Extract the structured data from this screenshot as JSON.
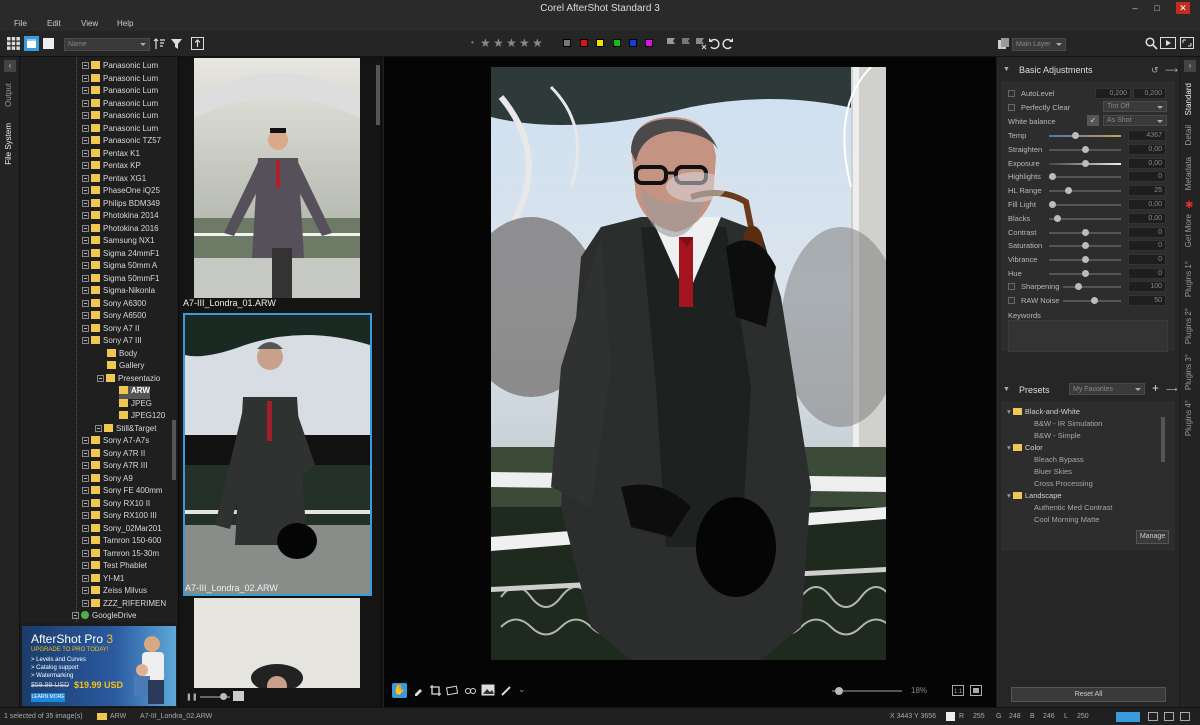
{
  "window": {
    "title": "Corel AfterShot Standard 3"
  },
  "menu": {
    "file": "File",
    "edit": "Edit",
    "view": "View",
    "help": "Help"
  },
  "toolbar": {
    "sort_by": "Name",
    "layer": "Main Layer"
  },
  "left_tabs": {
    "output": "Output",
    "file_system": "File System"
  },
  "tree": {
    "items": [
      "Panasonic Lum",
      "Panasonic Lum",
      "Panasonic Lum",
      "Panasonic Lum",
      "Panasonic Lum",
      "Panasonic Lum",
      "Panasonic TZ57",
      "Pentax K1",
      "Pentax KP",
      "Pentax XG1",
      "PhaseOne iQ25",
      "Philips BDM349",
      "Photokina 2014",
      "Photokina 2016",
      "Samsung NX1",
      "Sigma 24mmF1",
      "Sigma 50mm A",
      "Sigma 50mmF1",
      "Sigma-Nikonla",
      "Sony A6300",
      "Sony A6500",
      "Sony A7 II",
      "Sony A7 III"
    ],
    "sub_a7iii": [
      "Body",
      "Gallery",
      "Presentazio"
    ],
    "sub_pres": [
      "ARW",
      "JPEG",
      "JPEG120"
    ],
    "still_target": "Still&Target",
    "after": [
      "Sony A7-A7s",
      "Sony A7R II",
      "Sony A7R III",
      "Sony A9",
      "Sony FE 400mm",
      "Sony RX10 II",
      "Sony RX100 III",
      "Sony_02Mar201",
      "Tamron 150-600",
      "Tamron 15-30m",
      "Test Phablet",
      "YI-M1",
      "Zeiss Milvus",
      "ZZZ_RIFERIMEN"
    ],
    "drive": "GoogleDrive"
  },
  "ad": {
    "title": "AfterShot Pro",
    "title_num": "3",
    "upgrade": "UPGRADE TO PRO TODAY!",
    "bullets": [
      "> Levels and Curves",
      "> Catalog support",
      "> Watermarking"
    ],
    "old_price": "$59.99 USD",
    "new_price": "$19.99 USD",
    "cta": "LEARN MORE"
  },
  "filmstrip": {
    "captions": [
      "A7-III_Londra_01.ARW",
      "A7-III_Londra_02.ARW"
    ]
  },
  "viewer": {
    "zoom": "18%"
  },
  "right_tabs": [
    "Standard",
    "Detail",
    "Metadata",
    "Get More",
    "Plugins 1°",
    "Plugins 2°",
    "Plugins 3°",
    "Plugins 4°"
  ],
  "adjust": {
    "title": "Basic Adjustments",
    "autolevel": "AutoLevel",
    "autolevel_v1": "0,200",
    "autolevel_v2": "0,200",
    "perfectly_clear": "Perfectly Clear",
    "pc_mode": "Tint Off",
    "white_balance": "White balance",
    "wb_mode": "As Shot",
    "sliders": [
      {
        "label": "Temp",
        "value": "4367",
        "pos": 0.36
      },
      {
        "label": "Straighten",
        "value": "0,00",
        "pos": 0.5
      },
      {
        "label": "Exposure",
        "value": "0,00",
        "pos": 0.5
      },
      {
        "label": "Highlights",
        "value": "0",
        "pos": 0.0
      },
      {
        "label": "HL Range",
        "value": "25",
        "pos": 0.25
      },
      {
        "label": "Fill Light",
        "value": "0,00",
        "pos": 0.0
      },
      {
        "label": "Blacks",
        "value": "0,00",
        "pos": 0.08
      },
      {
        "label": "Contrast",
        "value": "0",
        "pos": 0.5
      },
      {
        "label": "Saturation",
        "value": "0",
        "pos": 0.5
      },
      {
        "label": "Vibrance",
        "value": "0",
        "pos": 0.5
      },
      {
        "label": "Hue",
        "value": "0",
        "pos": 0.5
      }
    ],
    "sharpening": "Sharpening",
    "sharpening_val": "100",
    "raw_noise": "RAW Noise",
    "raw_noise_val": "50",
    "keywords": "Keywords"
  },
  "presets": {
    "title": "Presets",
    "filter": "My Favorites",
    "items": [
      {
        "t": "Black-and-White",
        "folder": true
      },
      {
        "t": "B&W - IR Simulation",
        "folder": false
      },
      {
        "t": "B&W - Simple",
        "folder": false
      },
      {
        "t": "Color",
        "folder": true
      },
      {
        "t": "Bleach Bypass",
        "folder": false
      },
      {
        "t": "Bluer Skies",
        "folder": false
      },
      {
        "t": "Cross Processing",
        "folder": false
      },
      {
        "t": "Landscape",
        "folder": true
      },
      {
        "t": "Authentic Med Contrast",
        "folder": false
      },
      {
        "t": "Cool Morning Matte",
        "folder": false
      }
    ],
    "manage": "Manage",
    "reset_all": "Reset All"
  },
  "status": {
    "selected": "1 selected of 35 image(s)",
    "folder": "ARW",
    "file": "A7-III_Londra_02.ARW",
    "coords": "X 3443  Y 3656",
    "r_label": "R",
    "r": "255",
    "g_label": "G",
    "g": "248",
    "b_label": "B",
    "b": "246",
    "l_label": "L",
    "l": "250"
  },
  "colors": {
    "accent": "#3a9bdc",
    "label_colors": [
      "#e01010",
      "#f0e000",
      "#10c010",
      "#1040e0",
      "#e010e0"
    ]
  }
}
